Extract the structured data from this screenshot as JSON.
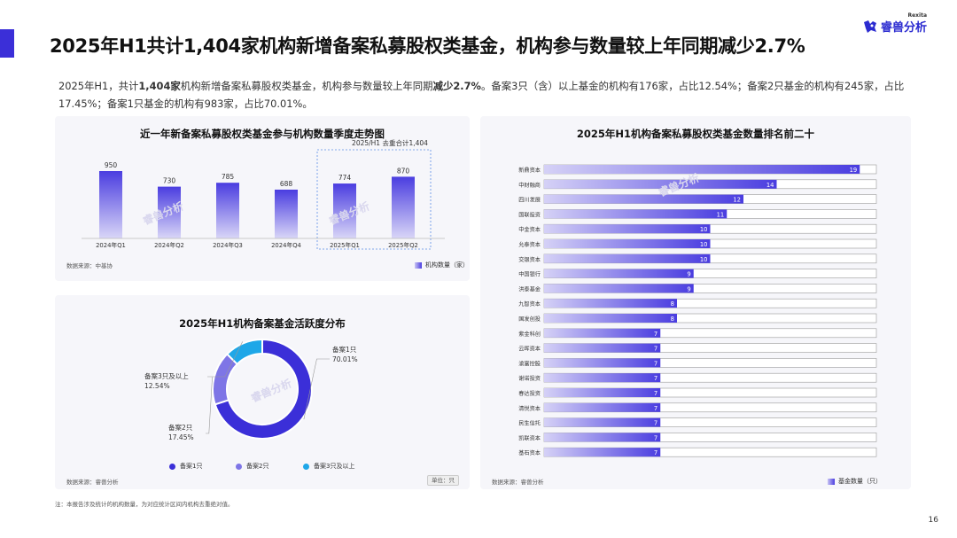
{
  "header": {
    "title": "2025年H1共计1,404家机构新增备案私募股权类基金，机构参与数量较上年同期减少2.7%",
    "logo_text": "睿兽分析",
    "logo_sub": "Rexita",
    "accent_color": "#3b2fd8"
  },
  "summary": {
    "p1": "2025年H1，共计",
    "b1": "1,404家",
    "p2": "机构新增备案私募股权类基金，机构参与数量较上年同期",
    "b2": "减少2.7%",
    "p3": "。备案3只（含）以上基金的机构有176家，占比12.54%；备案2只基金的机构有245家，占比17.45%；备案1只基金的机构有983家，占比70.01%。"
  },
  "chart_data": [
    {
      "type": "bar",
      "title": "近一年新备案私募股权类基金参与机构数量季度走势图",
      "categories": [
        "2024年Q1",
        "2024年Q2",
        "2024年Q3",
        "2024年Q4",
        "2025年Q1",
        "2025年Q2"
      ],
      "series": [
        {
          "name": "机构数量（家）",
          "values": [
            950,
            730,
            785,
            688,
            774,
            870
          ]
        }
      ],
      "annotation": "2025/H1 去重合计1,404",
      "highlight_categories": [
        "2025年Q1",
        "2025年Q2"
      ],
      "source": "数据来源：中基协",
      "ylim": [
        0,
        1000
      ],
      "grid": false,
      "bar_color_top": "#4a3de0",
      "bar_color_bottom": "#d9d6f7"
    },
    {
      "type": "pie",
      "title": "2025年H1机构备案基金活跃度分布",
      "donut": true,
      "slices": [
        {
          "label": "备案1只",
          "pct": "70.01%",
          "value": 70.01,
          "color": "#3b2fd8"
        },
        {
          "label": "备案2只",
          "pct": "17.45%",
          "value": 17.45,
          "color": "#7e75e6"
        },
        {
          "label": "备案3只及以上",
          "pct": "12.54%",
          "value": 12.54,
          "color": "#1ea7e8"
        }
      ],
      "source": "数据来源：睿兽分析",
      "unit_label": "单位：只"
    },
    {
      "type": "bar",
      "orientation": "horizontal",
      "title": "2025年H1机构备案私募股权类基金数量排名前二十",
      "categories": [
        "新鼎资本",
        "中财融商",
        "四川发展",
        "国联投资",
        "中金资本",
        "允泰资本",
        "交银资本",
        "中国银行",
        "洪泰基金",
        "九智资本",
        "国发创投",
        "紫金科创",
        "云晖资本",
        "渝富控股",
        "谢诺投资",
        "春达投资",
        "清悦资本",
        "民生信托",
        "凯联资本",
        "基石资本"
      ],
      "series": [
        {
          "name": "基金数量（只）",
          "values": [
            19,
            14,
            12,
            11,
            10,
            10,
            10,
            9,
            9,
            8,
            8,
            7,
            7,
            7,
            7,
            7,
            7,
            7,
            7,
            7
          ]
        }
      ],
      "xlim": [
        0,
        20
      ],
      "source": "数据来源：睿兽分析"
    }
  ],
  "footer": {
    "note": "注：本报告涉及统计的机构数量，为对应统计区间内机构去重绝对值。",
    "page": "16"
  },
  "watermark": "睿兽分析"
}
